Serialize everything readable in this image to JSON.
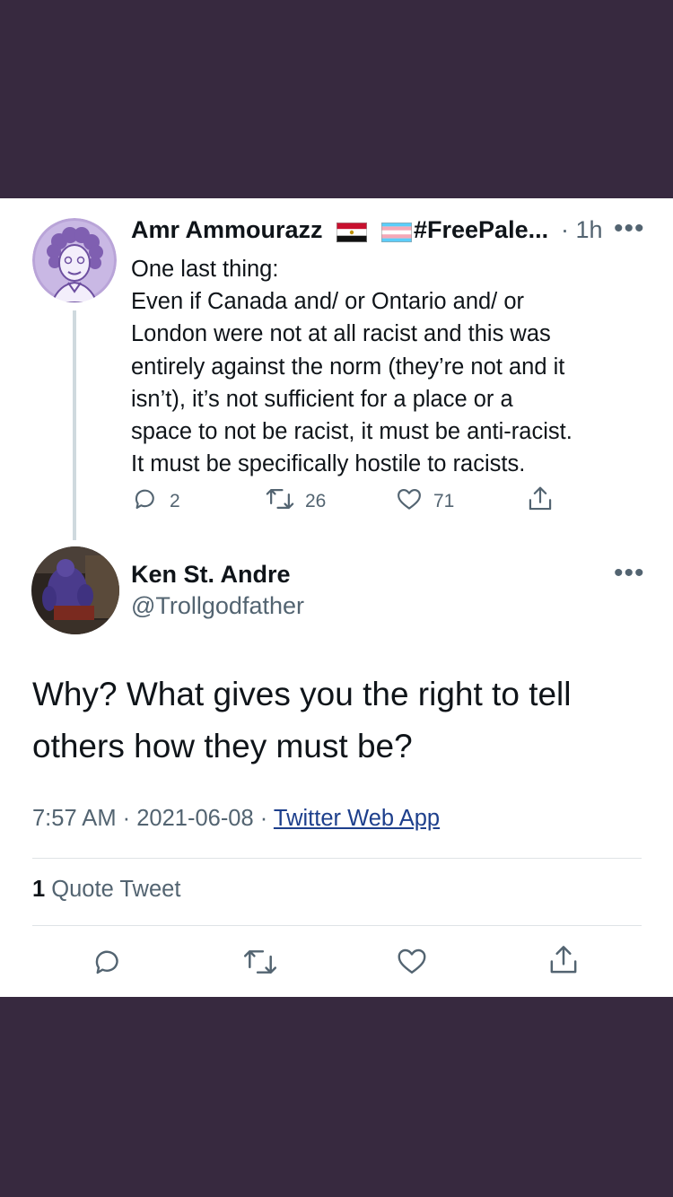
{
  "colors": {
    "background": "#37293f",
    "card": "#ffffff",
    "text": "#0f1419",
    "secondary": "#536471",
    "link": "#1d3f8c"
  },
  "parent_tweet": {
    "author_name": "Amr Ammourazz",
    "hashtag": "#FreePale...",
    "time": "· 1h",
    "lines": [
      "One last thing:",
      "Even if Canada and/ or Ontario and/ or",
      "London were not at all racist and this was",
      "entirely against the norm (they’re not and it",
      "isn’t), it’s not sufficient for a place or a",
      "space to not be racist, it must be anti-racist.",
      "It must be specifically hostile to racists."
    ],
    "replies": "2",
    "retweets": "26",
    "likes": "71",
    "icons": [
      "reply-icon",
      "retweet-icon",
      "like-icon",
      "share-icon"
    ]
  },
  "main_tweet": {
    "author_name": "Ken St. Andre",
    "handle": "@Trollgodfather",
    "lines": [
      "Why? What gives you the right to tell",
      "others how they must be?"
    ],
    "time": "7:57 AM",
    "date": "2021-06-08",
    "source": "Twitter Web App",
    "quote_count": "1",
    "quote_label": "Quote Tweet"
  }
}
